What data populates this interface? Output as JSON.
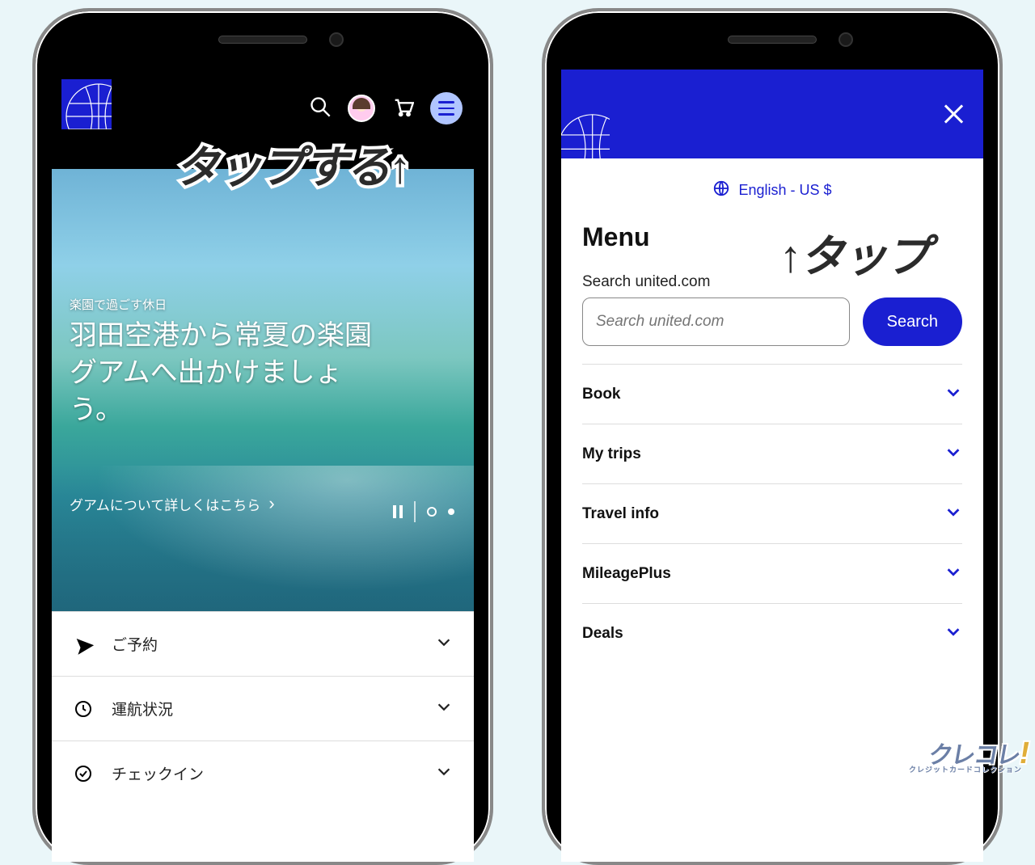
{
  "left": {
    "annotation": "タップする↑",
    "hero": {
      "eyebrow": "楽園で過ごす休日",
      "title_l1": "羽田空港から常夏の楽園",
      "title_l2": "グアムへ出かけましょ",
      "title_l3": "う。",
      "cta": "グアムについて詳しくはこちら"
    },
    "rows": {
      "book": "ご予約",
      "status": "運航状況",
      "checkin": "チェックイン"
    }
  },
  "right": {
    "annotation": "↑タップ",
    "language": "English - US $",
    "menu_title": "Menu",
    "search_label": "Search united.com",
    "search_placeholder": "Search united.com",
    "search_button": "Search",
    "items": {
      "book": "Book",
      "mytrips": "My trips",
      "travel": "Travel info",
      "miles": "MileagePlus",
      "deals": "Deals"
    }
  },
  "watermark": {
    "main": "クレコレ",
    "sub": "クレジットカードコレクション"
  }
}
